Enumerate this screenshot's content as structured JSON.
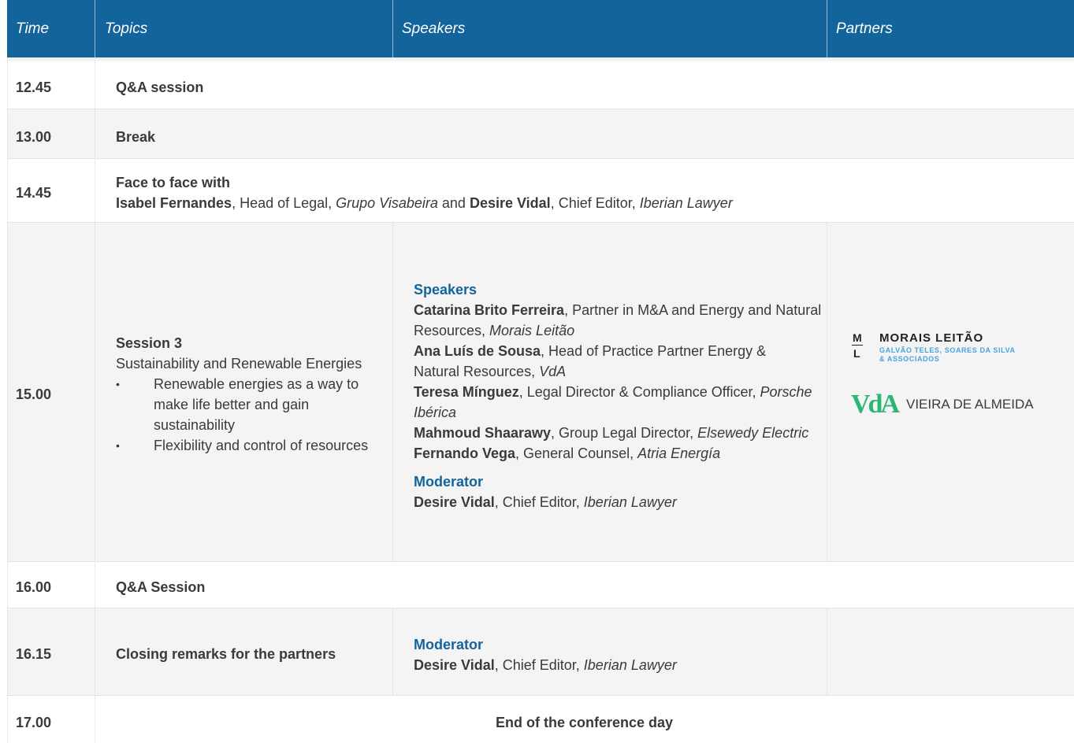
{
  "header": {
    "time": "Time",
    "topics": "Topics",
    "speakers": "Speakers",
    "partners": "Partners"
  },
  "rows": {
    "r1245": {
      "time": "12.45",
      "topic": "Q&A session"
    },
    "r1300": {
      "time": "13.00",
      "topic": "Break"
    },
    "r1445": {
      "time": "14.45",
      "title": "Face to face with",
      "p1_name": "Isabel Fernandes",
      "p1_role": ", Head of Legal, ",
      "p1_org": "Grupo Visabeira",
      "and": " and ",
      "p2_name": "Desire Vidal",
      "p2_role": ", Chief Editor, ",
      "p2_org": "Iberian Lawyer"
    },
    "r1500": {
      "time": "15.00",
      "session_title": "Session 3",
      "session_subtitle": "Sustainability and Renewable Energies",
      "bullets": [
        "Renewable energies as a way to make life better and gain sustainability",
        "Flexibility and control of resources"
      ],
      "speakers_heading": "Speakers",
      "speakers": [
        {
          "name": "Catarina Brito Ferreira",
          "role": ", Partner in M&A and Energy and Natural Resources, ",
          "org": "Morais Leitão"
        },
        {
          "name": "Ana Luís de Sousa",
          "role": ", Head of Practice Partner Energy & Natural Resources, ",
          "org": "VdA"
        },
        {
          "name": "Teresa Mínguez",
          "role": ", Legal Director & Compliance Officer, ",
          "org": "Porsche Ibérica"
        },
        {
          "name": "Mahmoud Shaarawy",
          "role": ", Group Legal Director, ",
          "org": "Elsewedy Electric"
        },
        {
          "name": "Fernando Vega",
          "role": ", General Counsel, ",
          "org": "Atria Energía"
        }
      ],
      "moderator_heading": "Moderator",
      "moderator": {
        "name": "Desire Vidal",
        "role": ", Chief Editor, ",
        "org": "Iberian Lawyer"
      },
      "partners": {
        "ml_name": "MORAIS LEITÃO",
        "ml_sub1": "GALVÃO TELES, SOARES DA SILVA",
        "ml_sub2": "& ASSOCIADOS",
        "ml_mark_top": "M",
        "ml_mark_bottom": "L",
        "vda_mark": "VdA",
        "vda_name": "VIEIRA DE ALMEIDA"
      }
    },
    "r1600": {
      "time": "16.00",
      "topic": "Q&A Session"
    },
    "r1615": {
      "time": "16.15",
      "topic": "Closing remarks for the partners",
      "moderator_heading": "Moderator",
      "moderator": {
        "name": "Desire Vidal",
        "role": ", Chief Editor, ",
        "org": "Iberian Lawyer"
      }
    },
    "r1700": {
      "time": "17.00",
      "topic": "End of the conference day"
    }
  },
  "colors": {
    "header_bg": "#14649c",
    "accent": "#14649c",
    "ml_sub": "#4aa3df",
    "vda_green": "#2bb673",
    "grey_row": "#f4f4f4"
  }
}
